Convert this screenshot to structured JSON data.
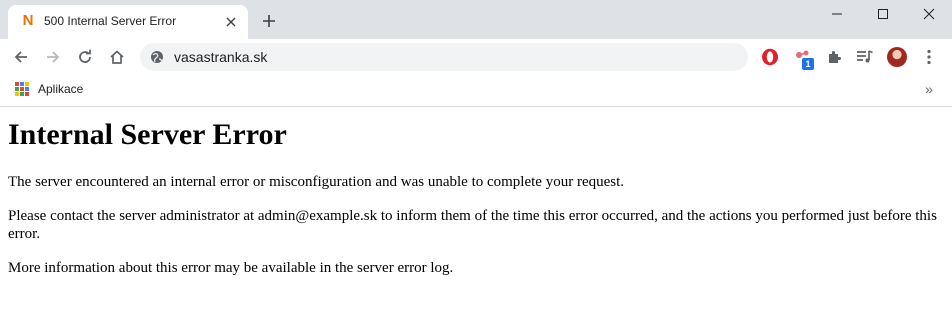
{
  "browser": {
    "tab": {
      "title": "500 Internal Server Error",
      "favicon": "N"
    },
    "new_tab_label": "+",
    "address": "vasastranka.sk",
    "bookmarks": {
      "apps_label": "Aplikace",
      "more_label": "»"
    },
    "extension_badge": "1",
    "icons": [
      "back-icon",
      "forward-icon",
      "reload-icon",
      "home-icon",
      "site-info-icon",
      "opera-icon",
      "extension-share-icon",
      "puzzle-icon",
      "media-queue-icon",
      "profile-avatar",
      "kebab-menu-icon",
      "minimize-icon",
      "maximize-icon",
      "close-window-icon"
    ],
    "colors": {
      "tabstrip": "#dee1e6",
      "omnibox": "#f1f3f4",
      "favicon": "#e8730c",
      "opera": "#e0202a"
    }
  },
  "page": {
    "heading": "Internal Server Error",
    "paragraphs": [
      "The server encountered an internal error or misconfiguration and was unable to complete your request.",
      "Please contact the server administrator at admin@example.sk to inform them of the time this error occurred, and the actions you performed just before this error.",
      "More information about this error may be available in the server error log."
    ]
  }
}
